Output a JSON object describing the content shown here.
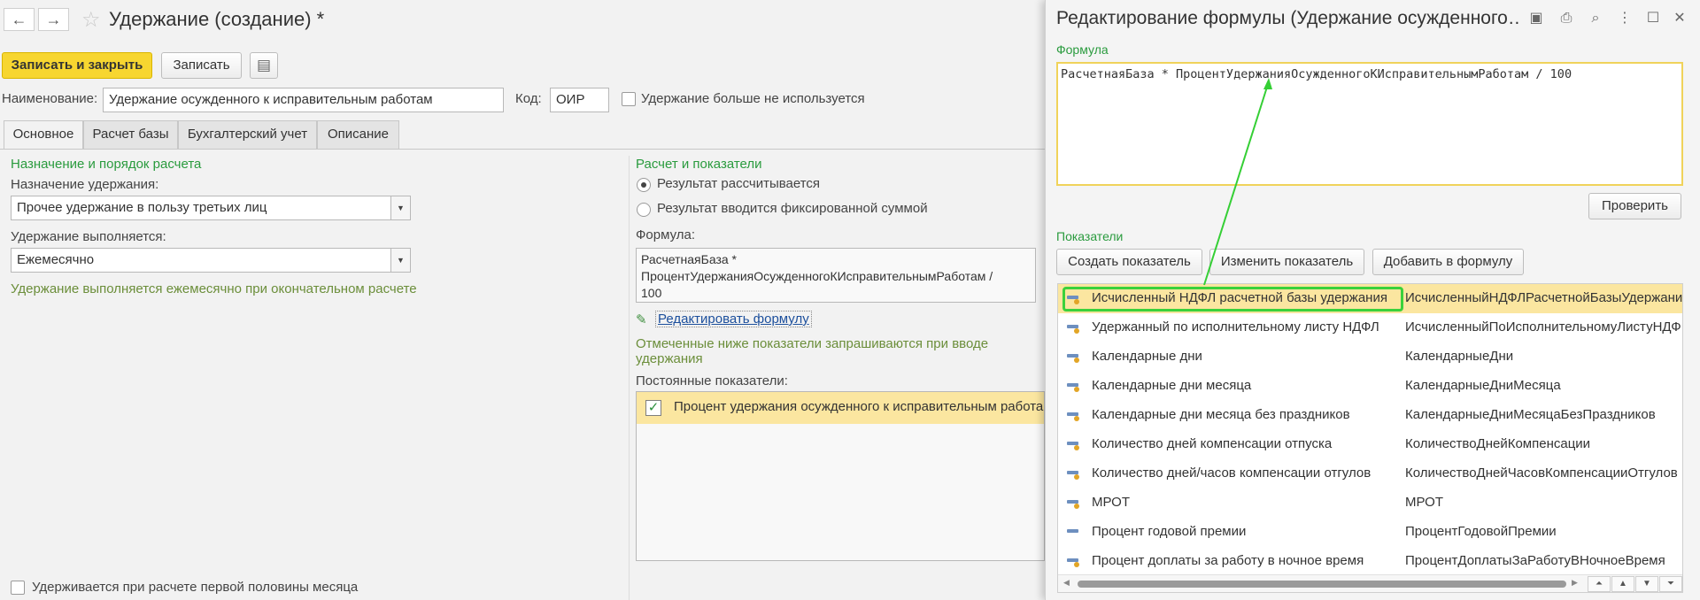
{
  "form": {
    "title": "Удержание (создание) *",
    "nav_back": "←",
    "nav_forward": "→",
    "star": "☆",
    "buttons": {
      "save_close": "Записать и закрыть",
      "save": "Записать",
      "doc_icon": "▤"
    },
    "name_label": "Наименование:",
    "name_value": "Удержание осужденного к исправительным работам",
    "code_label": "Код:",
    "code_value": "ОИР",
    "unused_label": "Удержание больше не используется",
    "tabs": [
      "Основное",
      "Расчет базы",
      "Бухгалтерский учет",
      "Описание"
    ],
    "left_section": {
      "heading": "Назначение и порядок расчета",
      "purpose_label": "Назначение удержания:",
      "purpose_value": "Прочее удержание в пользу третьих лиц",
      "performed_label": "Удержание выполняется:",
      "performed_value": "Ежемесячно",
      "note": "Удержание выполняется ежемесячно при окончательном расчете",
      "first_half_label": "Удерживается при расчете первой половины месяца"
    },
    "right_section": {
      "heading": "Расчет и показатели",
      "radio_calc": "Результат рассчитывается",
      "radio_fixed": "Результат вводится фиксированной суммой",
      "formula_label": "Формула:",
      "formula_lines": [
        "РасчетнаяБаза *",
        "ПроцентУдержанияОсужденногоКИсправительнымРаботам /",
        "100"
      ],
      "edit_link": "Редактировать формулу",
      "pencil": "✎",
      "note": "Отмеченные ниже показатели запрашиваются при вводе удержания",
      "const_label": "Постоянные показатели:",
      "const_item": "Процент удержания осужденного к исправительным работам",
      "const_check": "✓"
    }
  },
  "editor": {
    "title": "Редактирование формулы (Удержание осужденного…",
    "icons": {
      "save": "💾",
      "print": "⎙",
      "preview": "🔍",
      "more": "⋮",
      "maximize": "☐",
      "close": "✕"
    },
    "formula_label": "Формула",
    "formula_text": "РасчетнаяБаза * ПроцентУдержанияОсужденногоКИсправительнымРаботам / 100",
    "check_button": "Проверить",
    "indicators_label": "Показатели",
    "buttons": {
      "create": "Создать показатель",
      "change": "Изменить показатель",
      "add": "Добавить в формулу"
    },
    "rows": [
      {
        "name": "Исчисленный НДФЛ расчетной базы удержания",
        "id": "ИсчисленныйНДФЛРасчетнойБазыУдержани",
        "selected": true
      },
      {
        "name": "Удержанный по исполнительному листу НДФЛ",
        "id": "ИсчисленныйПоИсполнительномуЛистуНДФ"
      },
      {
        "name": "Календарные дни",
        "id": "КалендарныеДни"
      },
      {
        "name": "Календарные дни месяца",
        "id": "КалендарныеДниМесяца"
      },
      {
        "name": "Календарные дни месяца без праздников",
        "id": "КалендарныеДниМесяцаБезПраздников"
      },
      {
        "name": "Количество дней компенсации отпуска",
        "id": "КоличествоДнейКомпенсации"
      },
      {
        "name": "Количество дней/часов компенсации отгулов",
        "id": "КоличествоДнейЧасовКомпенсацииОтгулов"
      },
      {
        "name": "МРОТ",
        "id": "МРОТ"
      },
      {
        "name": "Процент годовой премии",
        "id": "ПроцентГодовойПремии",
        "icon_plain": true
      },
      {
        "name": "Процент доплаты за работу в ночное время",
        "id": "ПроцентДоплатыЗаРаботуВНочноеВремя"
      }
    ],
    "scroll_nav": [
      "⏶",
      "▲",
      "▼",
      "⏷"
    ]
  },
  "colors": {
    "accent_green": "#2a9b3e",
    "highlight": "#3bd13b",
    "selected_row": "#fbe6a0",
    "primary_button": "#f7d630"
  }
}
